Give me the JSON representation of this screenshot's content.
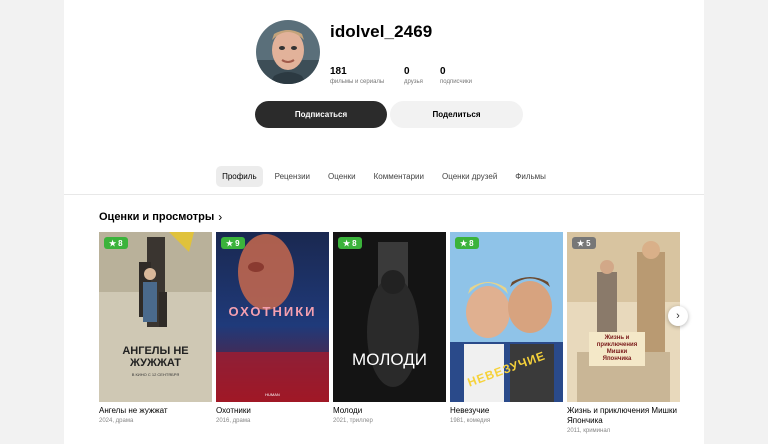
{
  "profile": {
    "username": "idolvel_2469",
    "stats": [
      {
        "value": "181",
        "label": "фильмы и сериалы"
      },
      {
        "value": "0",
        "label": "друзья"
      },
      {
        "value": "0",
        "label": "подписчики"
      }
    ],
    "subscribe_label": "Подписаться",
    "share_label": "Поделиться"
  },
  "tabs": [
    {
      "label": "Профиль",
      "active": true
    },
    {
      "label": "Рецензии"
    },
    {
      "label": "Оценки"
    },
    {
      "label": "Комментарии"
    },
    {
      "label": "Оценки друзей"
    },
    {
      "label": "Фильмы"
    }
  ],
  "ratings_section": {
    "title": "Оценки и просмотры",
    "chevron_icon": "chevron-right-icon",
    "next_icon": "chevron-right-icon",
    "star_icon": "star-icon",
    "items": [
      {
        "rating": "8",
        "title": "Ангелы не жужжат",
        "meta": "2024, драма",
        "poster_text": "АНГЕЛЫ НЕ ЖУЖЖАТ",
        "poster_sub": "В КИНО С 12 СЕНТЯБРЯ"
      },
      {
        "rating": "9",
        "title": "Охотники",
        "meta": "2016, драма",
        "poster_text": "ОХОТНИКИ",
        "poster_sub": "HUMAN"
      },
      {
        "rating": "8",
        "title": "Молоди",
        "meta": "2021, триллер",
        "poster_text": "МОЛОДИ",
        "poster_sub": ""
      },
      {
        "rating": "8",
        "title": "Невезучие",
        "meta": "1981, комедия",
        "poster_text": "НЕВЕЗУЧИЕ",
        "poster_sub": ""
      },
      {
        "rating": "5",
        "title": "Жизнь и приключения Мишки Япончика",
        "meta": "2011, криминал",
        "poster_text": "Жизнь и приключения Мишки Япончика",
        "poster_sub": ""
      }
    ]
  },
  "colors": {
    "rating_good": "#3bb33b",
    "rating_mid": "#777777",
    "primary_button": "#2b2b2b"
  }
}
